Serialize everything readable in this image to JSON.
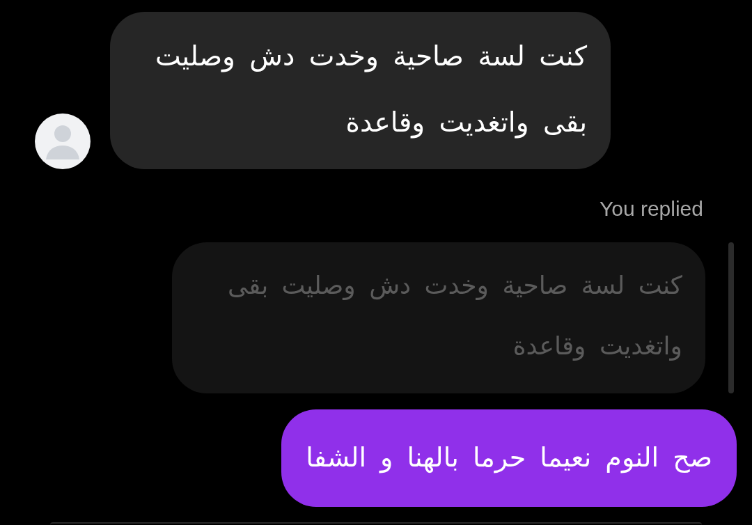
{
  "messages": [
    {
      "kind": "incoming",
      "text": "كنت لسة صاحية وخدت دش وصليت بقى واتغديت وقاعدة"
    },
    {
      "kind": "reply_label",
      "text": "You replied"
    },
    {
      "kind": "quoted",
      "text": "كنت لسة صاحية وخدت دش وصليت بقى واتغديت وقاعدة"
    },
    {
      "kind": "outgoing",
      "text": "صح النوم نعيما حرما بالهنا و الشفا"
    }
  ]
}
